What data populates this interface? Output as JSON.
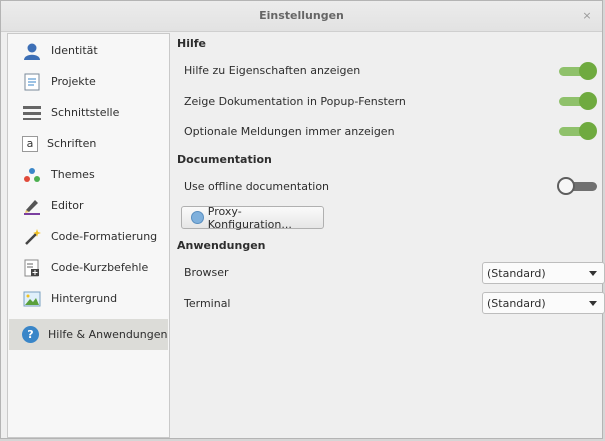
{
  "window": {
    "title": "Einstellungen",
    "close_glyph": "×"
  },
  "sidebar": {
    "items": [
      {
        "label": "Identität",
        "icon": "person-icon"
      },
      {
        "label": "Projekte",
        "icon": "document-icon"
      },
      {
        "label": "Schnittstelle",
        "icon": "interface-icon"
      },
      {
        "label": "Schriften",
        "icon": "font-icon",
        "glyph": "a"
      },
      {
        "label": "Themes",
        "icon": "themes-icon"
      },
      {
        "label": "Editor",
        "icon": "editor-pen-icon"
      },
      {
        "label": "Code-Formatierung",
        "icon": "magic-wand-icon"
      },
      {
        "label": "Code-Kurzbefehle",
        "icon": "shortcuts-icon"
      },
      {
        "label": "Hintergrund",
        "icon": "image-icon"
      },
      {
        "label": "Hilfe & Anwendungen",
        "icon": "help-icon",
        "glyph": "?",
        "active": true
      }
    ]
  },
  "main": {
    "help": {
      "heading": "Hilfe",
      "options": [
        {
          "label": "Hilfe zu Eigenschaften anzeigen",
          "enabled": true
        },
        {
          "label": "Zeige Dokumentation in Popup-Fenstern",
          "enabled": true
        },
        {
          "label": "Optionale Meldungen immer anzeigen",
          "enabled": true
        }
      ]
    },
    "documentation": {
      "heading": "Documentation",
      "options": [
        {
          "label": "Use offline documentation",
          "enabled": false
        }
      ],
      "proxy_button": "Proxy-Konfiguration..."
    },
    "applications": {
      "heading": "Anwendungen",
      "rows": [
        {
          "label": "Browser",
          "value": "(Standard)"
        },
        {
          "label": "Terminal",
          "value": "(Standard)"
        }
      ]
    }
  },
  "colors": {
    "accent_green": "#6faa3f",
    "selected_bg": "#dcdcd8",
    "help_blue": "#3a86c8"
  }
}
